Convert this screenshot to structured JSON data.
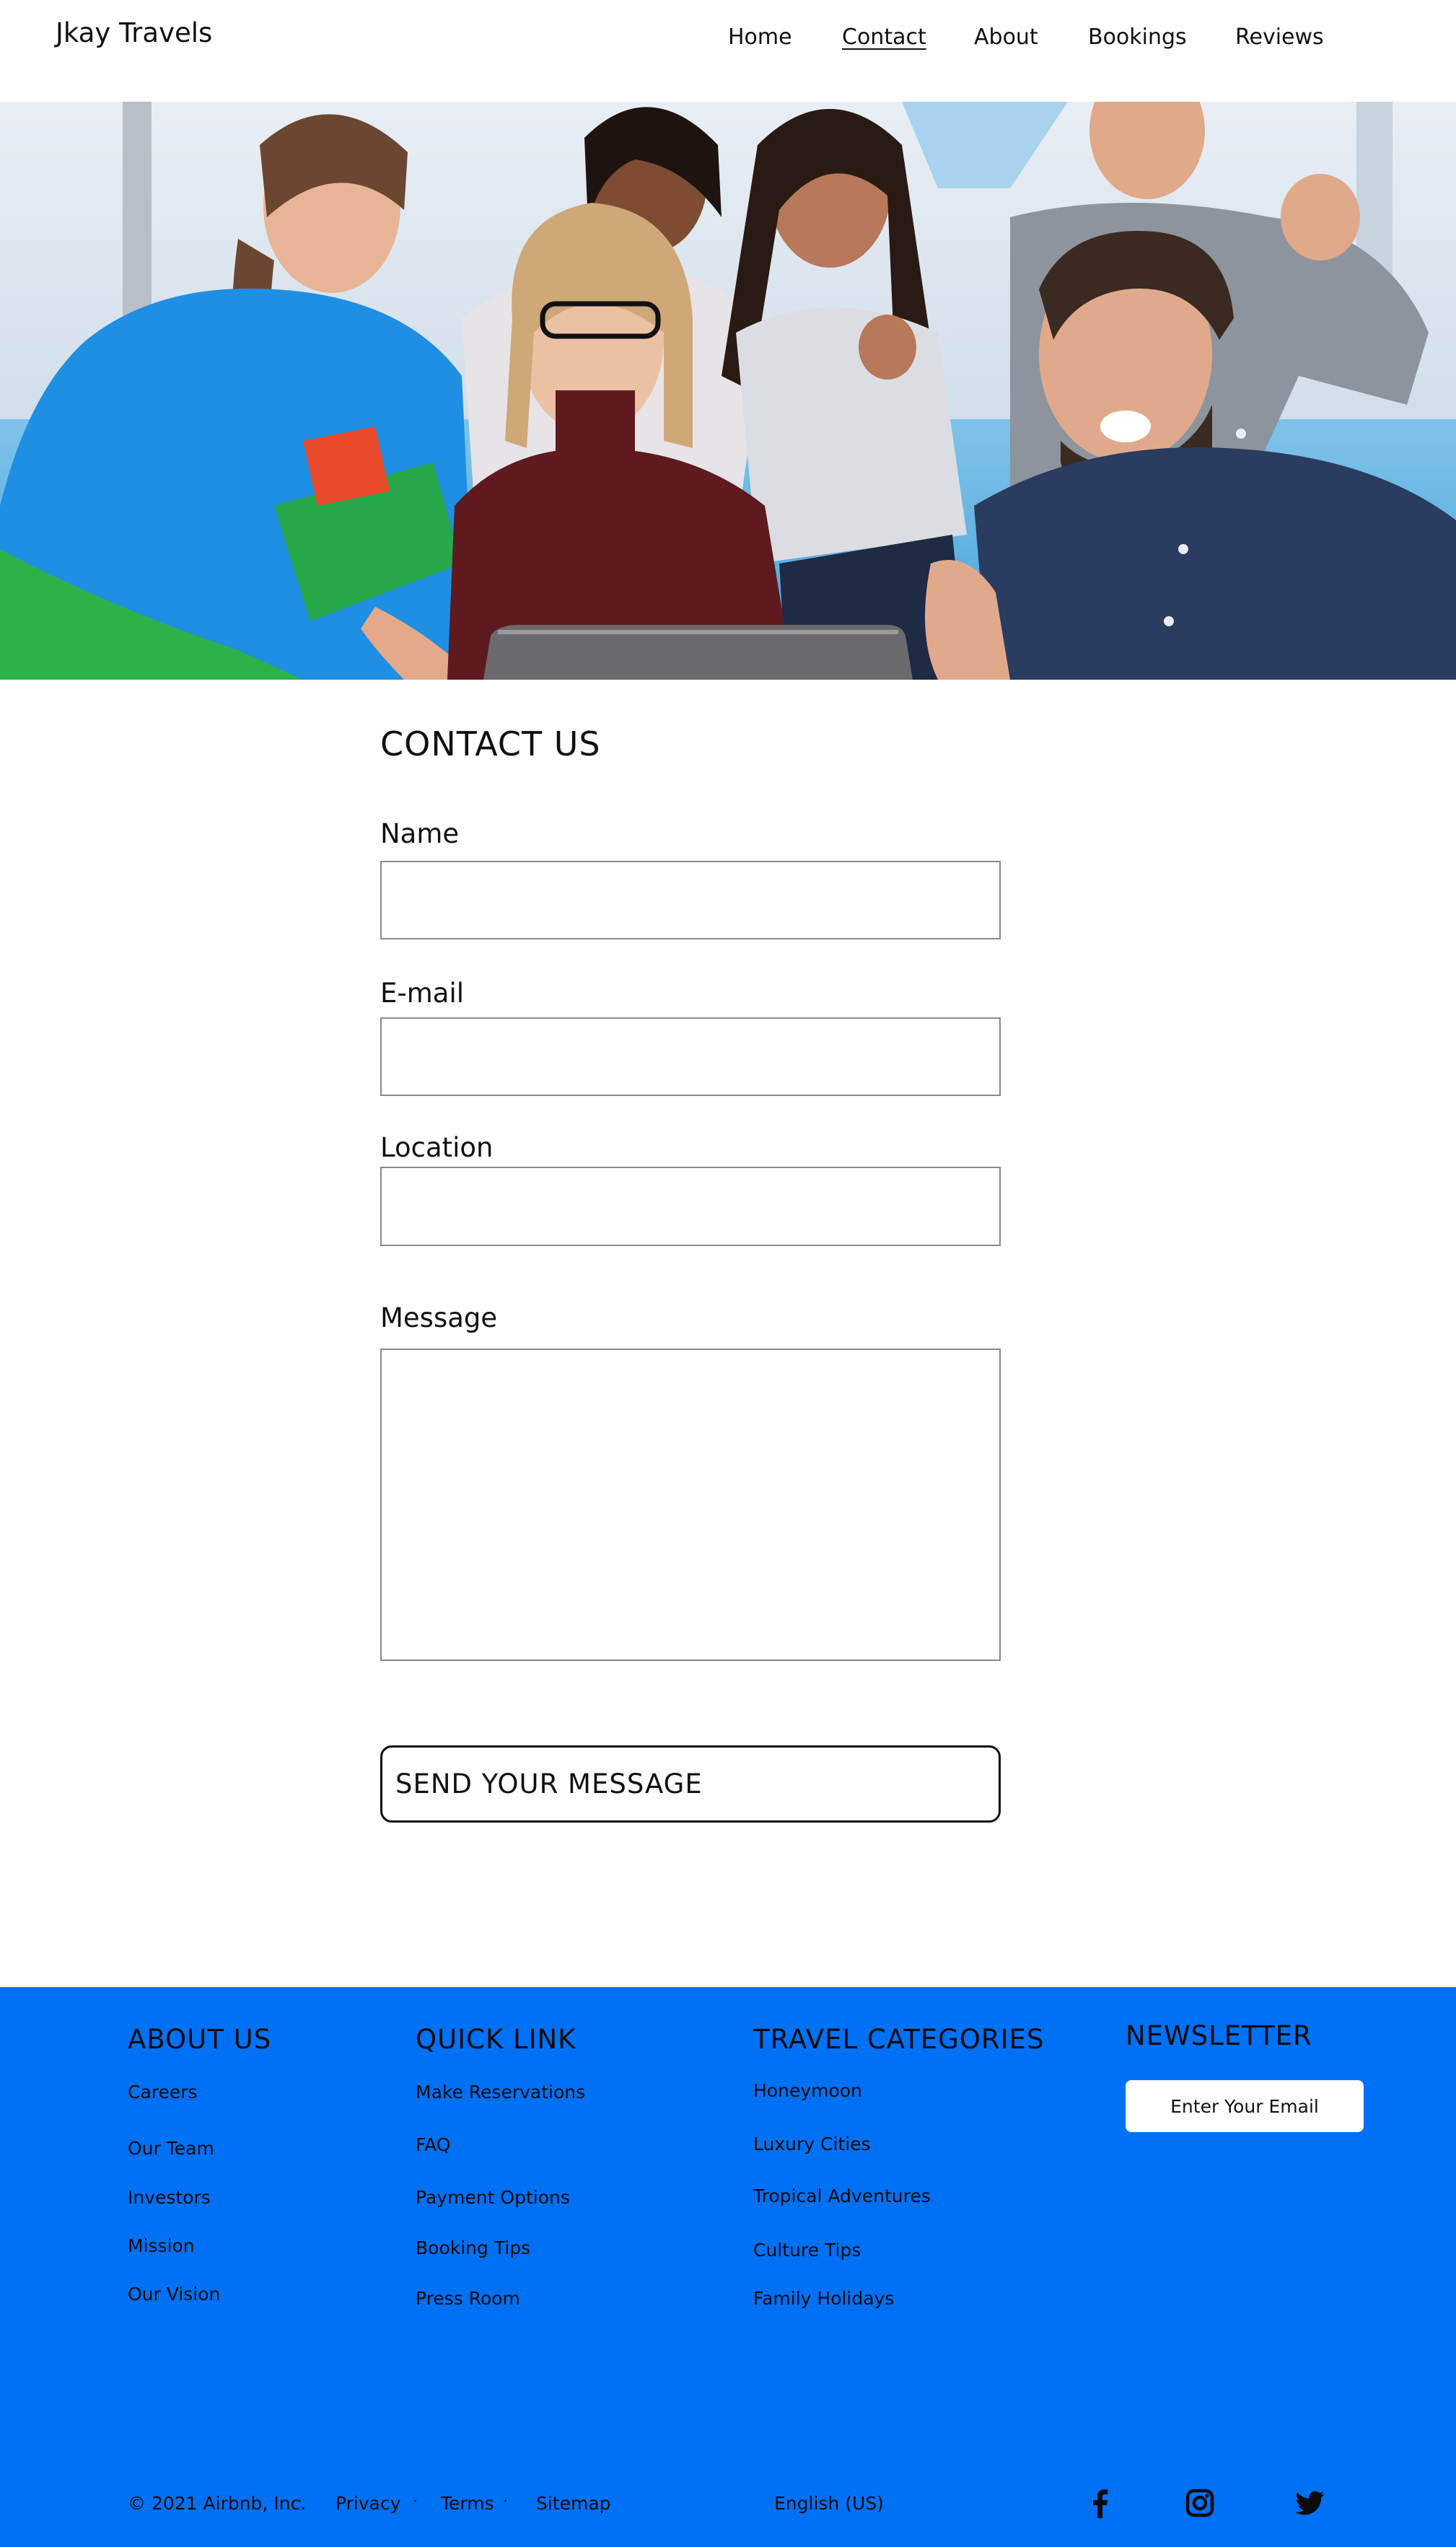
{
  "header": {
    "logo": "Jkay Travels",
    "nav": [
      "Home",
      "Contact",
      "About",
      "Bookings",
      "Reviews"
    ],
    "active_nav": "Contact"
  },
  "hero": {
    "icon": "team-photo"
  },
  "form": {
    "title": "CONTACT US",
    "name_label": "Name",
    "name_value": "",
    "email_label": "E-mail",
    "email_value": "",
    "location_label": "Location",
    "location_value": "",
    "message_label": "Message",
    "message_value": "",
    "submit_label": "SEND YOUR MESSAGE"
  },
  "footer": {
    "about": {
      "title": "ABOUT US",
      "links": [
        "Careers",
        "Our Team",
        "Investors",
        "Mission",
        "Our Vision"
      ]
    },
    "quick": {
      "title": "QUICK LINK",
      "links": [
        "Make Reservations",
        "FAQ",
        "Payment Options",
        "Booking Tips",
        "Press Room"
      ]
    },
    "travel": {
      "title": "TRAVEL CATEGORIES",
      "links": [
        "Honeymoon",
        "Luxury Cities",
        "Tropical Adventures",
        "Culture Tips",
        "Family Holidays"
      ]
    },
    "newsletter": {
      "title": "NEWSLETTER",
      "placeholder": "Enter Your Email"
    },
    "bottom": {
      "copyright": "© 2021 Airbnb, Inc.",
      "privacy": "Privacy",
      "terms": "Terms",
      "sitemap": "Sitemap",
      "language": "English (US)",
      "separator": "·"
    },
    "social_icons": [
      "facebook-icon",
      "instagram-icon",
      "twitter-icon"
    ],
    "background_color": "#0070f4"
  }
}
